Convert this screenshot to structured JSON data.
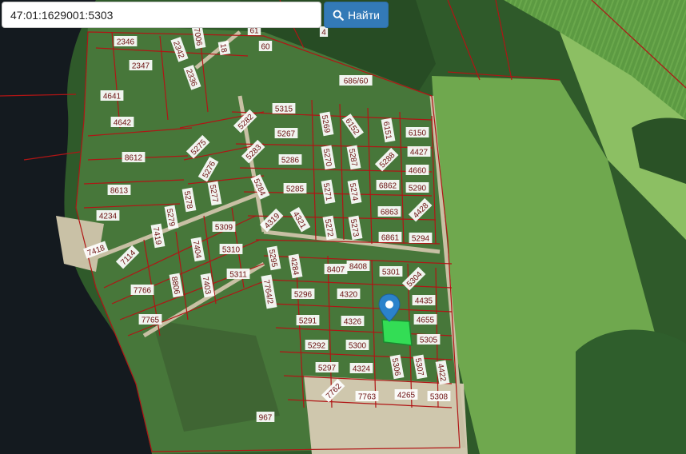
{
  "search": {
    "value": "47:01:1629001:5303",
    "button_label": "Найти",
    "button_icon": "search-icon"
  },
  "map": {
    "boundary_color": "#b01515",
    "highlight_color": "#33dd55",
    "marker_color": "#2b82cb",
    "parcels": [
      "2346",
      "2347",
      "2342",
      "2336",
      "7006",
      "18",
      "61",
      "60",
      "4",
      "4641",
      "4642",
      "8612",
      "8613",
      "4234",
      "7418",
      "686/60",
      "5315",
      "5282",
      "5267",
      "5283",
      "5286",
      "5269",
      "6152",
      "6151",
      "6150",
      "5270",
      "5287",
      "5288",
      "4427",
      "4660",
      "5271",
      "5274",
      "6862",
      "5290",
      "5285",
      "5284",
      "4428",
      "6863",
      "4319",
      "4321",
      "5272",
      "5273",
      "6861",
      "5294",
      "5275",
      "5276",
      "5278",
      "5277",
      "5279",
      "7419",
      "5309",
      "5310",
      "7404",
      "5311",
      "7403",
      "7114",
      "7766",
      "8806",
      "7765",
      "5295",
      "4284",
      "8407",
      "8408",
      "5301",
      "5304",
      "5296",
      "4320",
      "4435",
      "4655",
      "5291",
      "4326",
      "5305",
      "5292",
      "5300",
      "5297",
      "4324",
      "5306",
      "5307",
      "4422",
      "7762",
      "7763",
      "4265",
      "5308",
      "7764/2",
      "967"
    ]
  }
}
